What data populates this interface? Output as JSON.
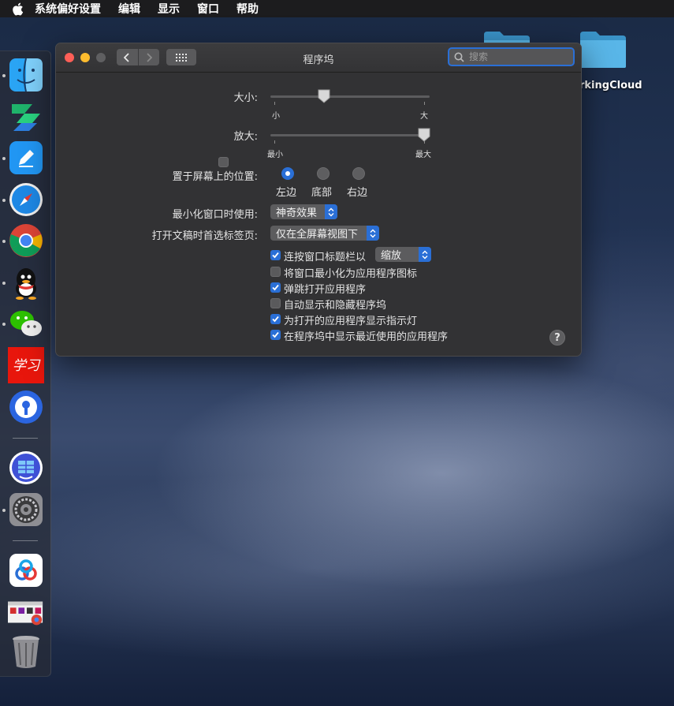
{
  "menubar": {
    "apple_icon": "apple-icon",
    "items": [
      "系统偏好设置",
      "编辑",
      "显示",
      "窗口",
      "帮助"
    ]
  },
  "desktop": {
    "folder_label": "rkingCloud"
  },
  "window": {
    "title": "程序坞",
    "search_placeholder": "搜索"
  },
  "settings": {
    "size_label": "大小:",
    "size_min": "小",
    "size_max": "大",
    "size_value": 0.33,
    "magnify_label": "放大:",
    "magnify_checked": false,
    "magnify_min": "最小",
    "magnify_max": "最大",
    "magnify_value": 1.0,
    "position_label": "置于屏幕上的位置:",
    "position_options": [
      "左边",
      "底部",
      "右边"
    ],
    "position_selected": "左边",
    "minimize_label": "最小化窗口时使用:",
    "minimize_value": "神奇效果",
    "tabs_label": "打开文稿时首选标签页:",
    "tabs_value": "仅在全屏幕视图下",
    "double_click_label": "连按窗口标题栏以",
    "double_click_checked": true,
    "double_click_value": "缩放",
    "checkboxes": [
      {
        "label": "将窗口最小化为应用程序图标",
        "checked": false
      },
      {
        "label": "弹跳打开应用程序",
        "checked": true
      },
      {
        "label": "自动显示和隐藏程序坞",
        "checked": false
      },
      {
        "label": "为打开的应用程序显示指示灯",
        "checked": true
      },
      {
        "label": "在程序坞中显示最近使用的应用程序",
        "checked": true
      }
    ],
    "help_label": "?"
  },
  "dock": {
    "apps": [
      "finder-icon",
      "app-green-icon",
      "notes-icon",
      "safari-icon",
      "chrome-icon",
      "qq-icon",
      "wechat-icon",
      "xuexi-icon",
      "app-blue-key-icon",
      "app-store-folder-icon",
      "system-preferences-icon",
      "baidu-netdisk-icon",
      "chrome-window-icon",
      "trash-icon"
    ]
  },
  "colors": {
    "accent": "#2a6fd6",
    "window_bg": "#323234",
    "close": "#fe5f57",
    "minimize": "#febc2e",
    "zoom_disabled": "#5f5f61"
  }
}
